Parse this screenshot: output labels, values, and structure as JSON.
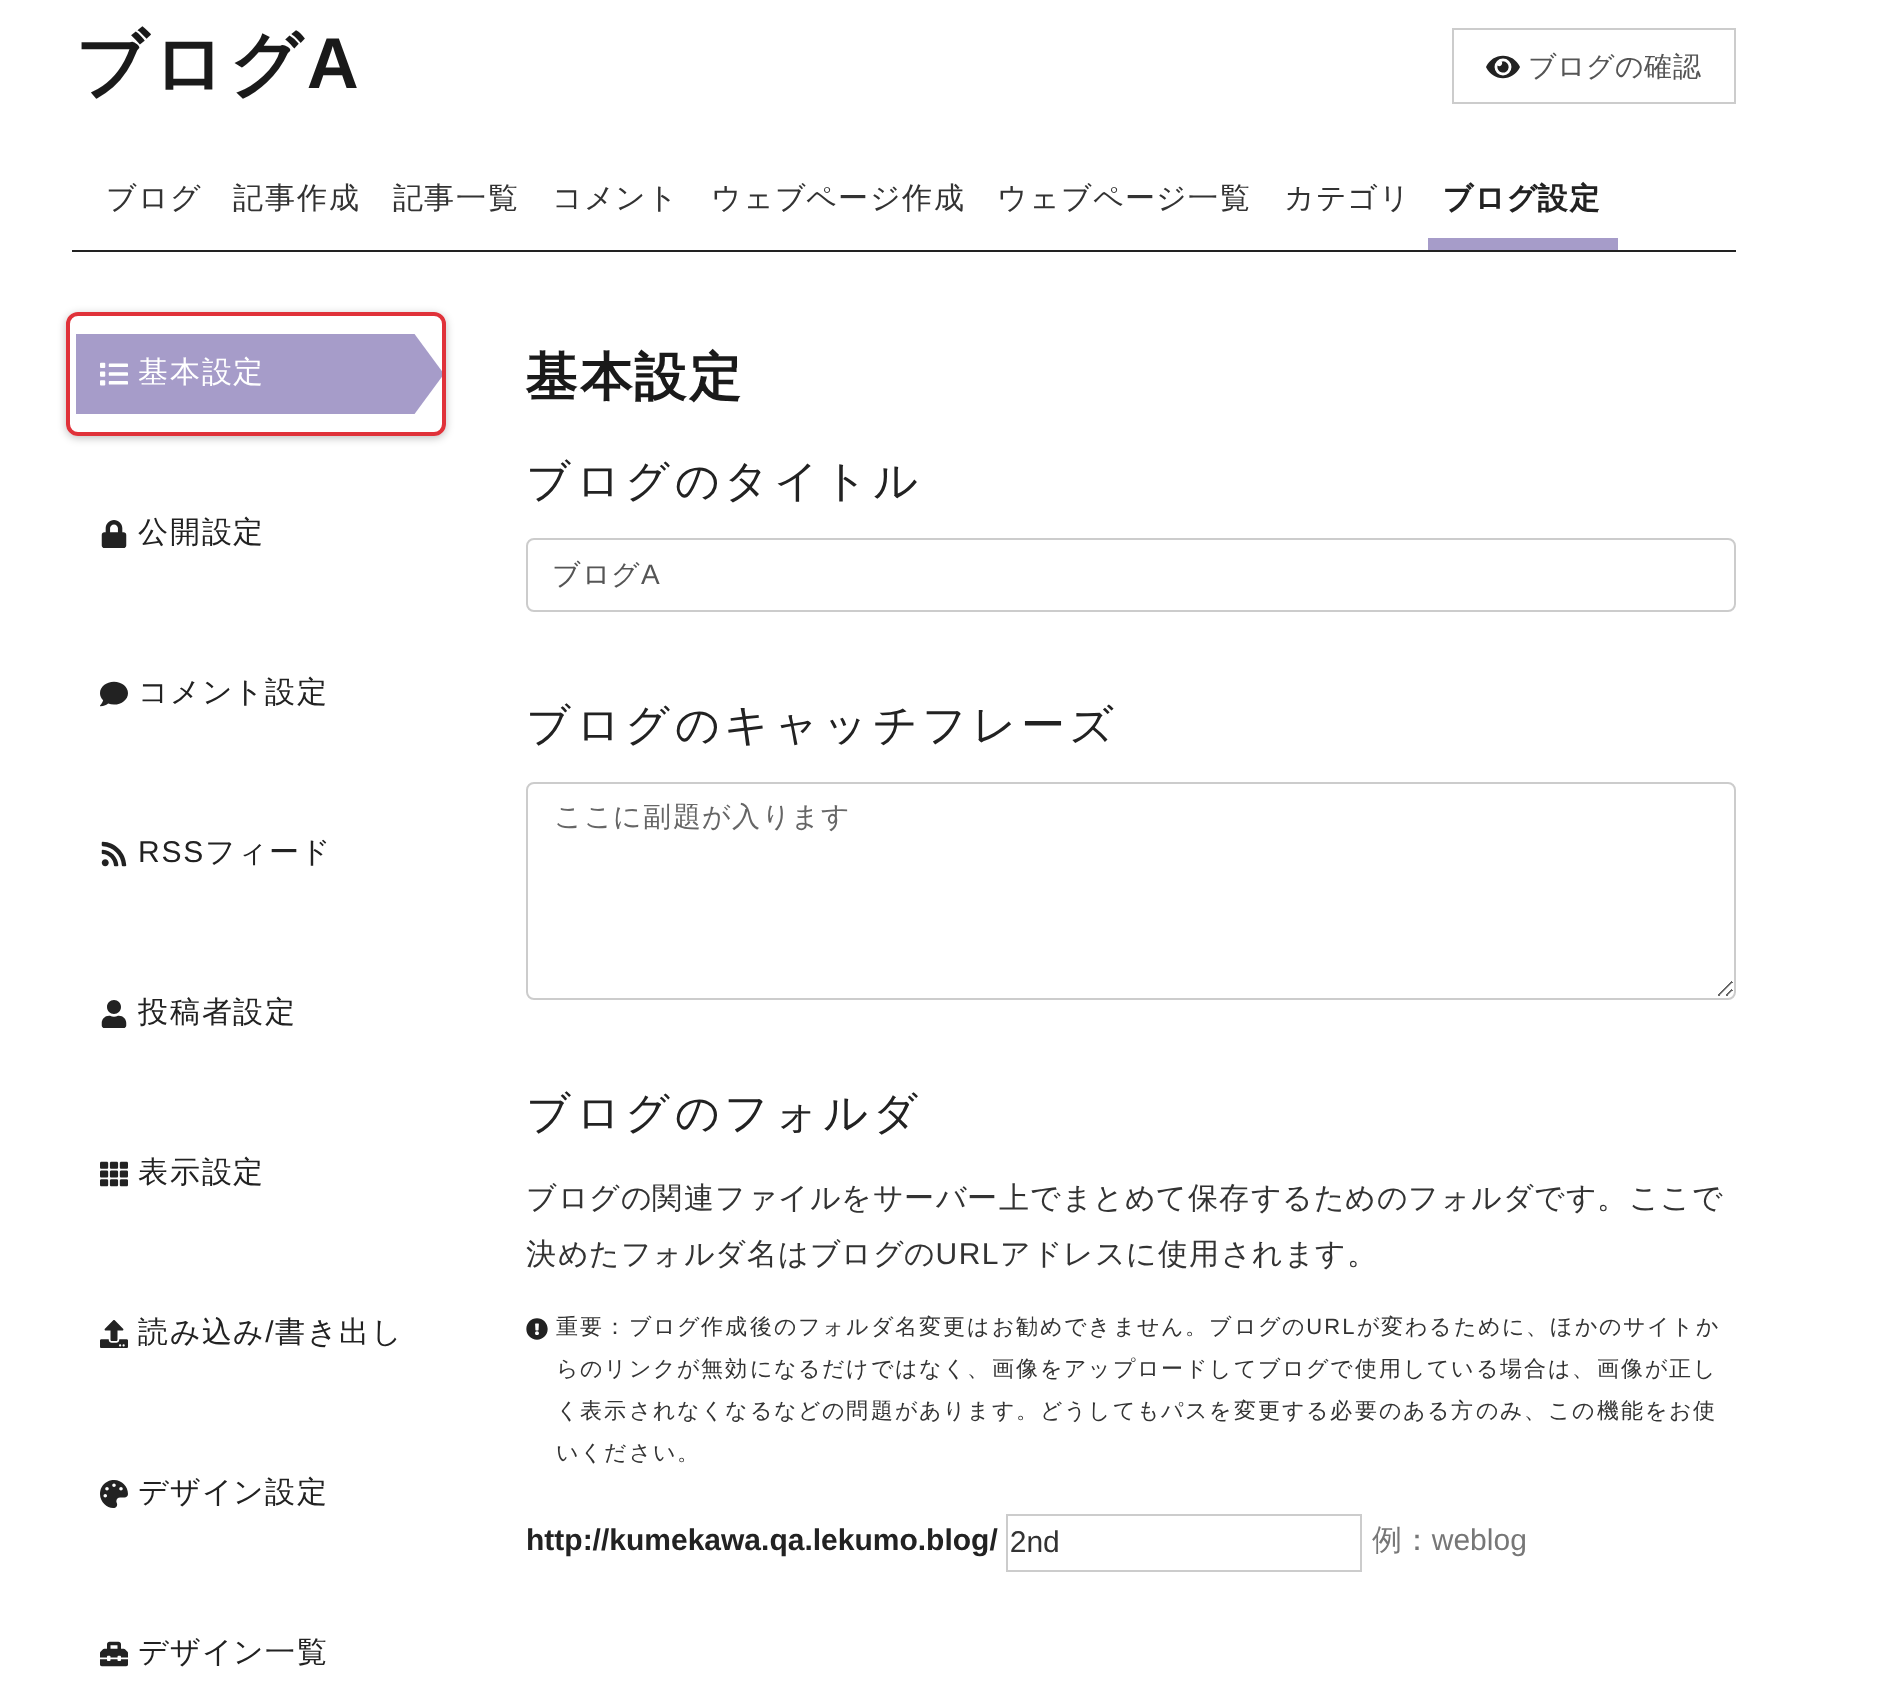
{
  "header": {
    "title": "ブログA",
    "view_button": "ブログの確認"
  },
  "tabs": [
    {
      "label": "ブログ",
      "selected": false
    },
    {
      "label": "記事作成",
      "selected": false
    },
    {
      "label": "記事一覧",
      "selected": false
    },
    {
      "label": "コメント",
      "selected": false
    },
    {
      "label": "ウェブページ作成",
      "selected": false
    },
    {
      "label": "ウェブページ一覧",
      "selected": false
    },
    {
      "label": "カテゴリ",
      "selected": false
    },
    {
      "label": "ブログ設定",
      "selected": true
    }
  ],
  "sidebar": {
    "items": [
      {
        "label": "基本設定",
        "selected": true,
        "highlighted": true
      },
      {
        "label": "公開設定",
        "selected": false,
        "highlighted": false
      },
      {
        "label": "コメント設定",
        "selected": false,
        "highlighted": false
      },
      {
        "label": "RSSフィード",
        "selected": false,
        "highlighted": false
      },
      {
        "label": "投稿者設定",
        "selected": false,
        "highlighted": false
      },
      {
        "label": "表示設定",
        "selected": false,
        "highlighted": false
      },
      {
        "label": "読み込み/書き出し",
        "selected": false,
        "highlighted": false
      },
      {
        "label": "デザイン設定",
        "selected": false,
        "highlighted": false
      },
      {
        "label": "デザイン一覧",
        "selected": false,
        "highlighted": false
      }
    ]
  },
  "main": {
    "heading": "基本設定",
    "title_field": {
      "label": "ブログのタイトル",
      "value": "ブログA"
    },
    "catchphrase_field": {
      "label": "ブログのキャッチフレーズ",
      "placeholder": "ここに副題が入ります"
    },
    "folder_field": {
      "label": "ブログのフォルダ",
      "description": "ブログの関連ファイルをサーバー上でまとめて保存するためのフォルダです。ここで決めたフォルダ名はブログのURLアドレスに使用されます。",
      "notice": "重要：ブログ作成後のフォルダ名変更はお勧めできません。ブログのURLが変わるために、ほかのサイトからのリンクが無効になるだけではなく、画像をアップロードしてブログで使用している場合は、画像が正しく表示されなくなるなどの問題があります。どうしてもパスを変更する必要のある方のみ、この機能をお使いください。",
      "url_prefix": "http://kumekawa.qa.lekumo.blog/",
      "value": "2nd",
      "example": "例：weblog"
    }
  }
}
